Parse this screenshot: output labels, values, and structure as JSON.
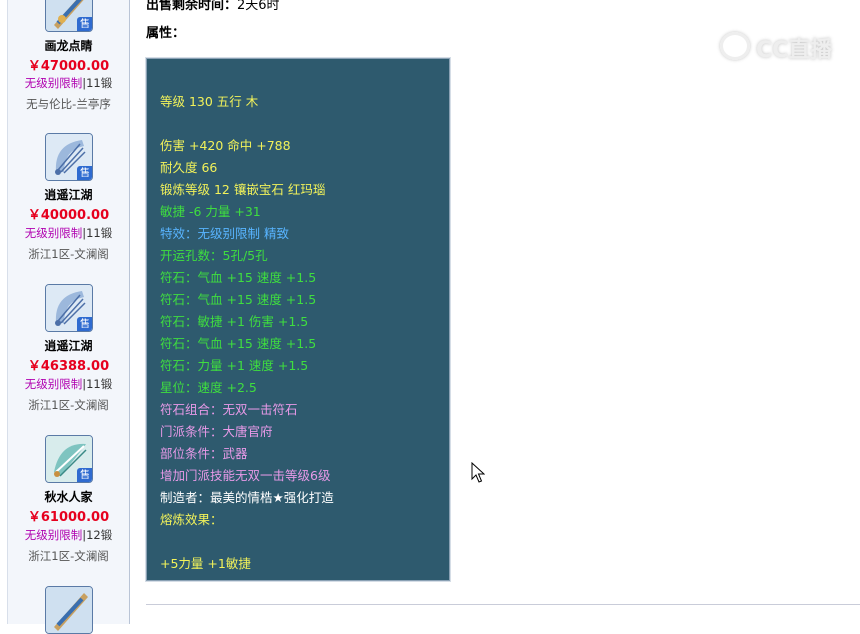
{
  "sidebar": {
    "items": [
      {
        "name": "画龙点睛",
        "price": "￥47000.00",
        "limit": "无级别限制",
        "sep": "|",
        "forge": "11锻",
        "server": "无与伦比-兰亭序",
        "badge": "售",
        "icon": "fan-item-icon"
      },
      {
        "name": "逍遥江湖",
        "price": "￥40000.00",
        "limit": "无级别限制",
        "sep": "|",
        "forge": "11锻",
        "server": "浙江1区-文澜阁",
        "badge": "售",
        "icon": "fan-item-icon"
      },
      {
        "name": "逍遥江湖",
        "price": "￥46388.00",
        "limit": "无级别限制",
        "sep": "|",
        "forge": "11锻",
        "server": "浙江1区-文澜阁",
        "badge": "售",
        "icon": "fan-item-icon"
      },
      {
        "name": "秋水人家",
        "price": "￥61000.00",
        "limit": "无级别限制",
        "sep": "|",
        "forge": "12锻",
        "server": "浙江1区-文澜阁",
        "badge": "售",
        "icon": "fan-item-icon"
      }
    ]
  },
  "main": {
    "remaining_label": "出售剩余时间：",
    "remaining_value": "2天6时",
    "attributes_label": "属性："
  },
  "attributes": {
    "lines": [
      {
        "text": "等级 130 五行 木",
        "color": "#f2f25a"
      },
      {
        "text": "伤害 +420 命中 +788",
        "color": "#f2f25a"
      },
      {
        "text": "耐久度 66",
        "color": "#f2f25a"
      },
      {
        "text": "锻炼等级 12 镶嵌宝石 红玛瑙",
        "color": "#f2f25a"
      },
      {
        "text": "敏捷 -6 力量 +31",
        "color": "#3fde3f"
      },
      {
        "text": "特效：无级别限制 精致",
        "color": "#58b4ff"
      },
      {
        "text": "开运孔数：5孔/5孔",
        "color": "#3fde3f"
      },
      {
        "text": "符石：气血 +15 速度 +1.5",
        "color": "#3fde3f"
      },
      {
        "text": "符石：气血 +15 速度 +1.5",
        "color": "#3fde3f"
      },
      {
        "text": "符石：敏捷 +1 伤害 +1.5",
        "color": "#3fde3f"
      },
      {
        "text": "符石：气血 +15 速度 +1.5",
        "color": "#3fde3f"
      },
      {
        "text": "符石：力量 +1 速度 +1.5",
        "color": "#3fde3f"
      },
      {
        "text": "星位：速度 +2.5",
        "color": "#3fde3f"
      },
      {
        "text": "符石组合：无双一击符石",
        "color": "#e89ae8"
      },
      {
        "text": "门派条件：大唐官府",
        "color": "#e89ae8"
      },
      {
        "text": "部位条件：武器",
        "color": "#e89ae8"
      },
      {
        "text": "增加门派技能无双一击等级6级",
        "color": "#e89ae8"
      },
      {
        "text": "制造者：最美的情梏★强化打造",
        "color": "#ffffff"
      },
      {
        "text": "熔炼效果：",
        "color": "#f2f25a"
      },
      {
        "text": "+5力量 +1敏捷",
        "color": "#f2f25a"
      }
    ]
  },
  "watermark": {
    "text": "CC直播"
  }
}
